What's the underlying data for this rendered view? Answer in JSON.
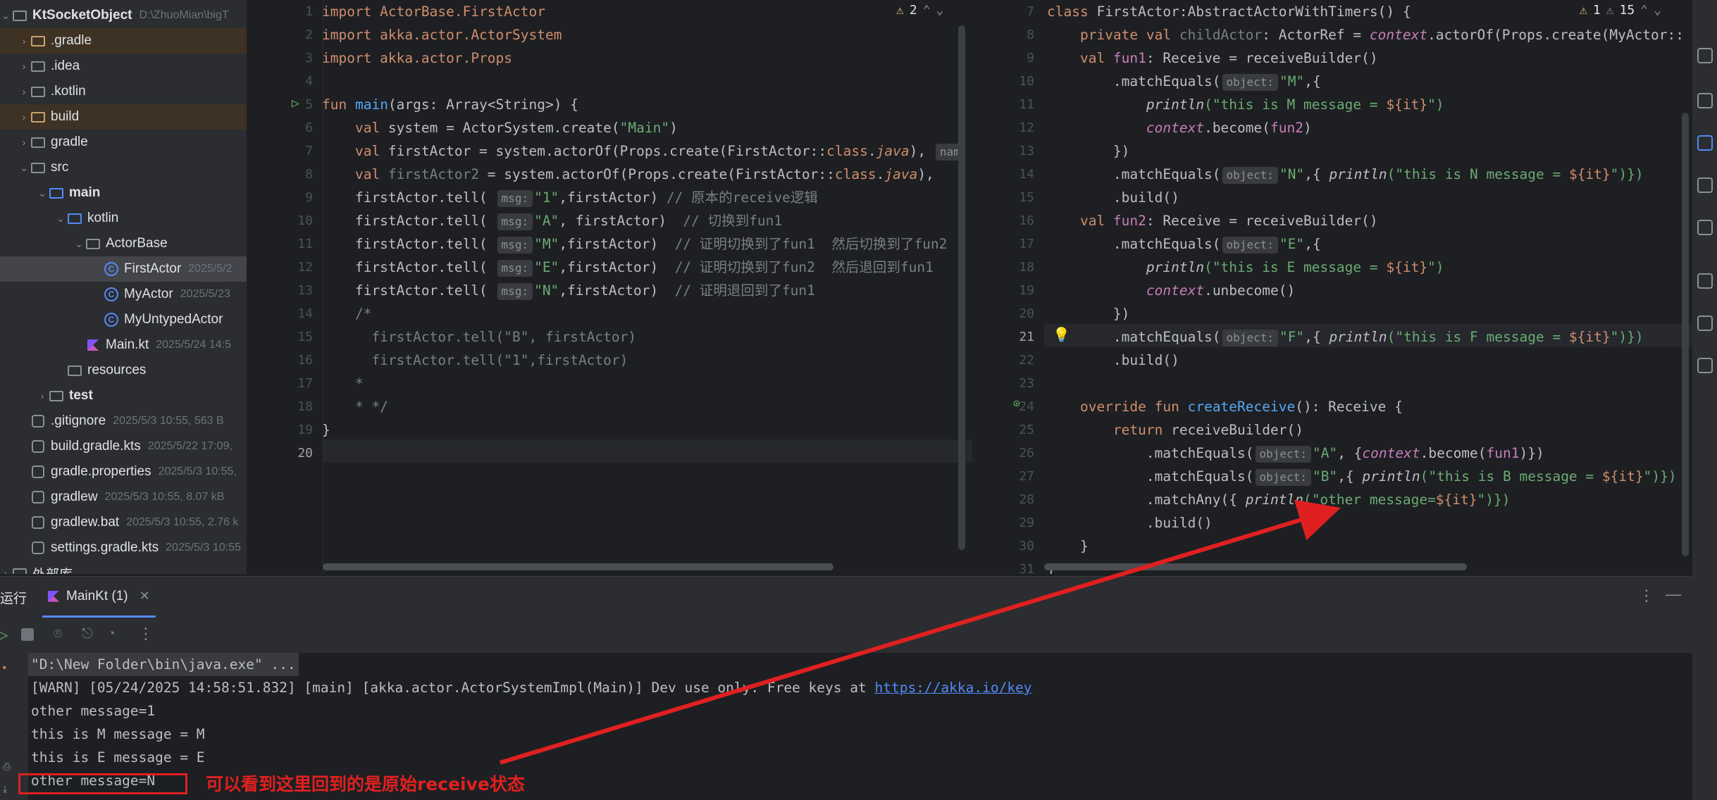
{
  "project": {
    "root_name": "KtSocketObject",
    "root_path": "D:\\ZhuoMian\\bigT",
    "items": [
      {
        "name": ".gradle",
        "meta": "",
        "kind": "folder-orange"
      },
      {
        "name": ".idea",
        "meta": "",
        "kind": "folder"
      },
      {
        "name": ".kotlin",
        "meta": "",
        "kind": "folder"
      },
      {
        "name": "build",
        "meta": "",
        "kind": "folder-orange"
      },
      {
        "name": "gradle",
        "meta": "",
        "kind": "folder"
      },
      {
        "name": "src",
        "meta": "",
        "kind": "folder"
      },
      {
        "name": "main",
        "meta": "",
        "kind": "folder-blue"
      },
      {
        "name": "kotlin",
        "meta": "",
        "kind": "folder-blue"
      },
      {
        "name": "ActorBase",
        "meta": "",
        "kind": "package"
      },
      {
        "name": "FirstActor",
        "meta": "2025/5/2",
        "kind": "class"
      },
      {
        "name": "MyActor",
        "meta": "2025/5/23",
        "kind": "class"
      },
      {
        "name": "MyUntypedActor",
        "meta": "",
        "kind": "class"
      },
      {
        "name": "Main.kt",
        "meta": "2025/5/24 14:5",
        "kind": "kt"
      },
      {
        "name": "resources",
        "meta": "",
        "kind": "folder"
      },
      {
        "name": "test",
        "meta": "",
        "kind": "folder"
      },
      {
        "name": ".gitignore",
        "meta": "2025/5/3 10:55, 563 B",
        "kind": "file"
      },
      {
        "name": "build.gradle.kts",
        "meta": "2025/5/22 17:09,",
        "kind": "file"
      },
      {
        "name": "gradle.properties",
        "meta": "2025/5/3 10:55,",
        "kind": "file"
      },
      {
        "name": "gradlew",
        "meta": "2025/5/3 10:55, 8.07 kB",
        "kind": "file"
      },
      {
        "name": "gradlew.bat",
        "meta": "2025/5/3 10:55, 2.76 k",
        "kind": "file"
      },
      {
        "name": "settings.gradle.kts",
        "meta": "2025/5/3 10:55",
        "kind": "file"
      },
      {
        "name": "外部库",
        "meta": "",
        "kind": "lib"
      }
    ]
  },
  "left_editor": {
    "warnings": "2",
    "line_numbers": [
      "1",
      "2",
      "3",
      "4",
      "5",
      "6",
      "7",
      "8",
      "9",
      "10",
      "11",
      "12",
      "13",
      "14",
      "15",
      "16",
      "17",
      "18",
      "19",
      "20"
    ],
    "l1": "import ActorBase.FirstActor",
    "l2": "import akka.actor.ActorSystem",
    "l3": "import akka.actor.Props",
    "l5_kw": "fun ",
    "l5_fn": "main",
    "l5_rest": "(args: Array<String>) {",
    "l6_a": "    val ",
    "l6_b": "system = ActorSystem.create(",
    "l6_str": "\"Main\"",
    "l6_c": ")",
    "l7_a": "    val ",
    "l7_b": "firstActor = system.actorOf(Props.create(FirstActor::",
    "l7_kw": "class",
    "l7_c": ".",
    "l7_java": "java",
    "l7_d": "), ",
    "l7_hint": "nam",
    "l8_a": "    val ",
    "l8_b": "firstActor2",
    "l8_c": " = system.actorOf(Props.create(FirstActor::",
    "l8_kw": "class",
    "l8_d": ".",
    "l8_java": "java",
    "l8_e": "), ",
    "tell_prefix": "    firstActor.tell( ",
    "msg_hint": "msg:",
    "l9_str": "\"1\"",
    "l9_rest": ",firstActor) ",
    "l9_cmt": "// 原本的receive逻辑",
    "l10_str": "\"A\"",
    "l10_rest": ", firstActor)  ",
    "l10_cmt": "// 切换到fun1",
    "l11_str": "\"M\"",
    "l11_rest": ",firstActor)  ",
    "l11_cmt": "// 证明切换到了fun1  然后切换到了fun2",
    "l12_str": "\"E\"",
    "l12_rest": ",firstActor)  ",
    "l12_cmt": "// 证明切换到了fun2  然后退回到fun1",
    "l13_str": "\"N\"",
    "l13_rest": ",firstActor)  ",
    "l13_cmt": "// 证明退回到了fun1",
    "l14": "    /*",
    "l15": "      firstActor.tell(\"B\", firstActor)",
    "l16": "      firstActor.tell(\"1\",firstActor)",
    "l17": "    *",
    "l18": "    * */",
    "l19": "}"
  },
  "right_editor": {
    "warnings": "1",
    "weak_warnings": "15",
    "line_numbers": [
      "7",
      "8",
      "9",
      "10",
      "11",
      "12",
      "13",
      "14",
      "15",
      "16",
      "17",
      "18",
      "19",
      "20",
      "21",
      "22",
      "23",
      "24",
      "25",
      "26",
      "27",
      "28",
      "29",
      "30",
      "31"
    ],
    "r7_kw": "class ",
    "r7_rest": "FirstActor:AbstractActorWithTimers() {",
    "r8_kw": "    private val ",
    "r8_prop": "childActor",
    "r8_a": ": ActorRef = ",
    "r8_ctx": "context",
    "r8_b": ".actorOf(Props.create(MyActor::",
    "r9_kw": "    val ",
    "r9_prop": "fun1",
    "r9_rest": ": Receive = receiveBuilder()",
    "match_eq": ".matchEquals(",
    "obj_hint": "object:",
    "r10_str": "\"M\"",
    "r10_rest": ",{",
    "println": "println",
    "r11_str": "(\"this is M message = ",
    "it_tpl": "${it}",
    "close_str_paren": "\")",
    "r12_ctx": "context",
    "r12_a": ".become(",
    "r12_prop": "fun2",
    "r12_b": ")",
    "r13": "        })",
    "r14_str": "\"N\"",
    "r14_a": ",{ ",
    "r14_str2": "(\"this is N message = ",
    "close_str_block": "\")})",
    "r15": "        .build()",
    "r16_prop": "fun2",
    "r17_str": "\"E\"",
    "r18_str": "(\"this is E message = ",
    "r19_a": ".unbecome()",
    "r21_str": "\"F\"",
    "r21_str2": "(\"this is F message = ",
    "r22": "        .build()",
    "r24_kw": "    override fun ",
    "r24_fn": "createReceive",
    "r24_rest": "(): Receive {",
    "r25_kw": "        return ",
    "r25_rest": "receiveBuilder()",
    "r26_str": "\"A\"",
    "r26_a": ", {",
    "r26_b": ".become(",
    "r26_c": ")})",
    "r27_str": "\"B\"",
    "r27_str2": "(\"this is B message = ",
    "r28_a": "            .matchAny({ ",
    "r28_str": "(\"other message=",
    "r28_end": "\")})",
    "r29": "            .build()",
    "r30": "    }",
    "r31": "}"
  },
  "run_panel": {
    "title": "运行",
    "tab_label": "MainKt (1)",
    "console": {
      "line1": "\"D:\\New Folder\\bin\\java.exe\" ...",
      "line2_prefix": "[WARN] [05/24/2025 14:58:51.832] [main] [akka.actor.ActorSystemImpl(Main)] Dev use only. Free keys at ",
      "line2_link": "https://akka.io/key",
      "line3": "other message=1",
      "line4": "this is M message = M",
      "line5": "this is E message = E",
      "line6": "other message=N"
    }
  },
  "annotation": {
    "note": "可以看到这里回到的是原始receive状态",
    "color": "#e02020"
  }
}
